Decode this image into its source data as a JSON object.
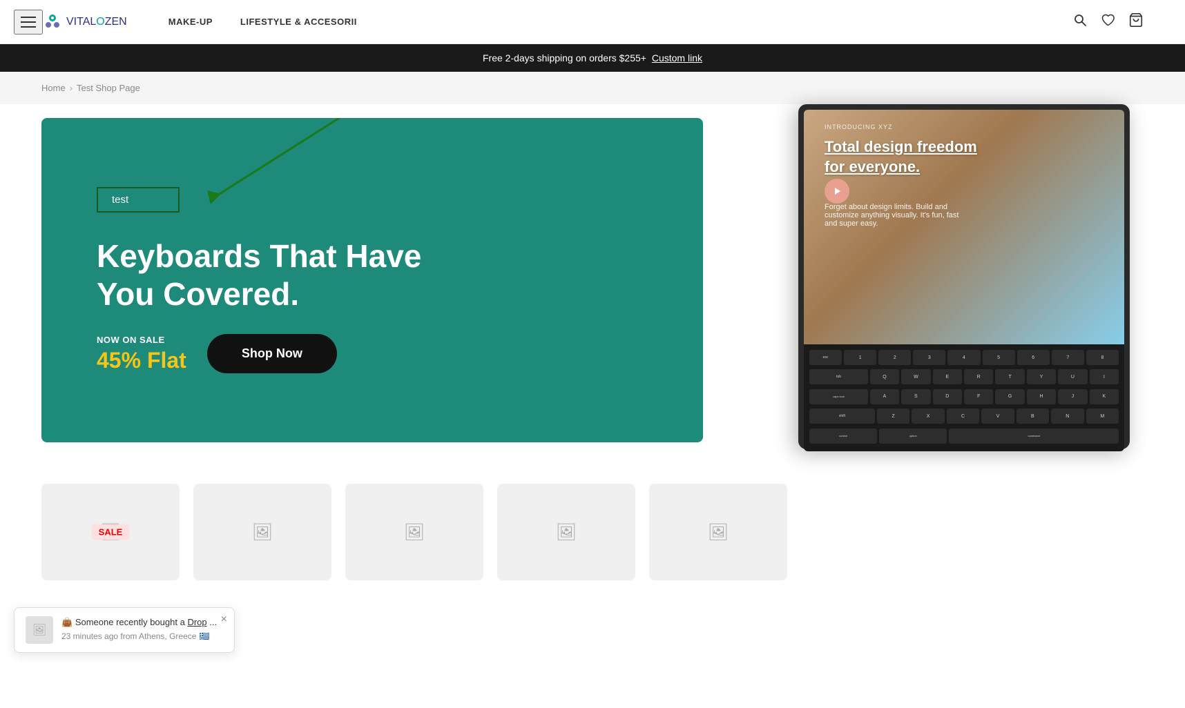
{
  "header": {
    "logo_vital": "VITAL",
    "logo_o": "O",
    "logo_zen": "ZEN",
    "nav_items": [
      {
        "label": "MAKE-UP",
        "id": "makeup"
      },
      {
        "label": "LIFESTYLE & ACCESORII",
        "id": "lifestyle"
      }
    ],
    "icons": {
      "search": "🔍",
      "wishlist": "♡",
      "cart": "🛒",
      "hamburger": "≡"
    }
  },
  "announcement": {
    "text": "Free 2-days shipping on orders $255+",
    "link_text": "Custom link"
  },
  "breadcrumb": {
    "home": "Home",
    "separator": "›",
    "current": "Test Shop Page"
  },
  "hero": {
    "test_label": "test",
    "title": "Keyboards That Have You Covered.",
    "sale_label": "NOW ON SALE",
    "discount": "45% Flat",
    "shop_now": "Shop Now",
    "tablet_intro": "INTRODUCING XYZ",
    "tablet_heading_line1": "Total design freedom",
    "tablet_heading_line2": "for everyone.",
    "tablet_subtext": "Forget about design limits. Build and customize anything visually. It's fun, fast and super easy."
  },
  "notification": {
    "icon": "👜",
    "text_prefix": "Someone recently bought a",
    "link_text": "Drop",
    "text_suffix": "...",
    "time_text": "23 minutes ago from Athens, Greece",
    "flag": "🇬🇷",
    "close": "×"
  },
  "products": {
    "sale_badge": "SALE",
    "placeholder_icon": "🖼"
  },
  "colors": {
    "teal": "#1e8a7a",
    "dark": "#111",
    "yellow": "#f5c518",
    "white": "#ffffff",
    "annotation_green": "#1a7a1a"
  }
}
